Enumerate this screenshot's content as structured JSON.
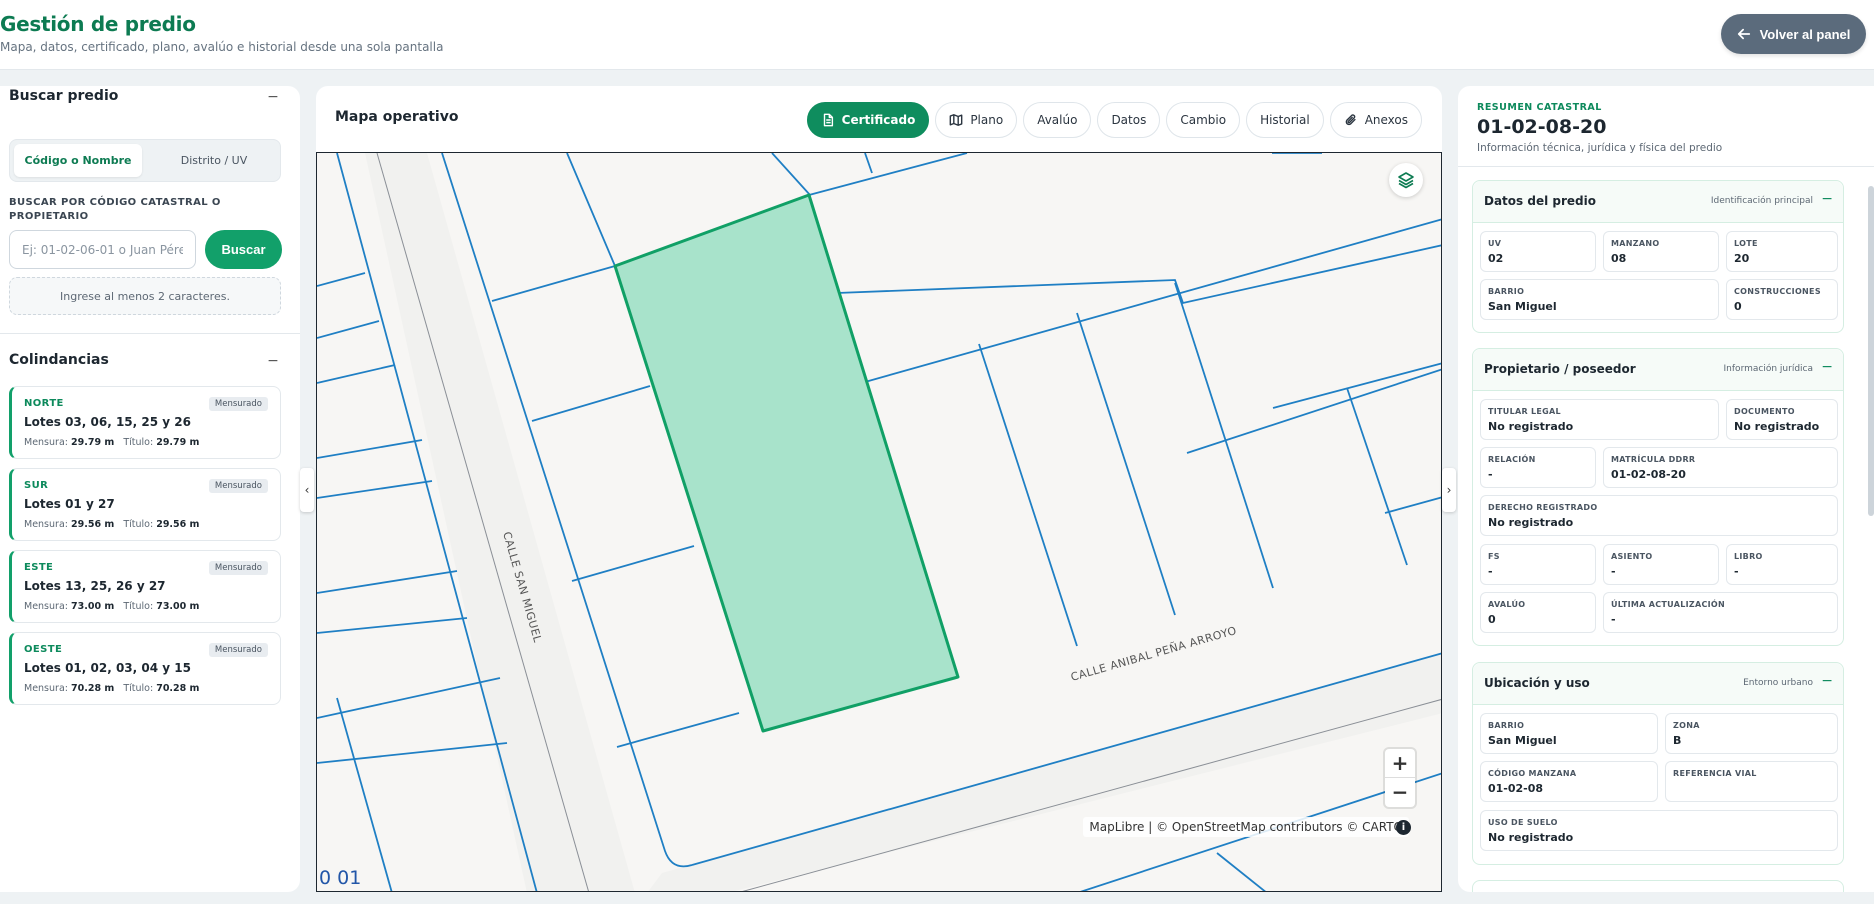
{
  "header": {
    "title": "Gestión de predio",
    "subtitle": "Mapa, datos, certificado, plano, avalúo e historial desde una sola pantalla",
    "back_label": "Volver al panel",
    "back_icon": "arrow-left-icon"
  },
  "search": {
    "title": "Buscar predio",
    "collapse": "−",
    "mode_code": "Código o Nombre",
    "mode_district": "Distrito / UV",
    "label": "BUSCAR POR CÓDIGO CATASTRAL O PROPIETARIO",
    "placeholder": "Ej: 01-02-06-01 o Juan Pérez",
    "button": "Buscar",
    "hint": "Ingrese al menos 2 caracteres."
  },
  "colindancias": {
    "title": "Colindancias",
    "collapse": "−",
    "mensura_label": "Mensura:",
    "titulo_label": "Título:",
    "items": [
      {
        "dir": "NORTE",
        "badge": "Mensurado",
        "lotes": "Lotes 03, 06, 15, 25 y 26",
        "mensura": "29.79 m",
        "titulo": "29.79 m"
      },
      {
        "dir": "SUR",
        "badge": "Mensurado",
        "lotes": "Lotes 01 y 27",
        "mensura": "29.56 m",
        "titulo": "29.56 m"
      },
      {
        "dir": "ESTE",
        "badge": "Mensurado",
        "lotes": "Lotes 13, 25, 26 y 27",
        "mensura": "73.00 m",
        "titulo": "73.00 m"
      },
      {
        "dir": "OESTE",
        "badge": "Mensurado",
        "lotes": "Lotes 01, 02, 03, 04 y 15",
        "mensura": "70.28 m",
        "titulo": "70.28 m"
      }
    ]
  },
  "map": {
    "title": "Mapa operativo",
    "tabs": [
      {
        "label": "Certificado",
        "icon": "document-icon"
      },
      {
        "label": "Plano",
        "icon": "map-icon"
      },
      {
        "label": "Avalúo",
        "icon": ""
      },
      {
        "label": "Datos",
        "icon": ""
      },
      {
        "label": "Cambio",
        "icon": ""
      },
      {
        "label": "Historial",
        "icon": ""
      },
      {
        "label": "Anexos",
        "icon": "paperclip-icon"
      }
    ],
    "street_1": "CALLE SAN MIGUEL",
    "street_2": "CALLE ANIBAL PEÑA ARROYO",
    "lot_label": "0 01",
    "attribution": "MapLibre | © OpenStreetMap contributors © CARTO",
    "zoom_in": "+",
    "zoom_out": "−",
    "info": "i",
    "handle_left": "‹",
    "handle_right": "›",
    "parcel_fill": "#a8e3cb",
    "parcel_stroke": "#11a066",
    "lot_lines": "#1f7fc4"
  },
  "summary": {
    "eyebrow": "RESUMEN CATASTRAL",
    "code": "01-02-08-20",
    "description": "Información técnica, jurídica y física del predio",
    "groups": {
      "predio": {
        "title": "Datos del predio",
        "tag": "Identificación principal",
        "collapse": "−",
        "fields": [
          {
            "label": "UV",
            "value": "02"
          },
          {
            "label": "MANZANO",
            "value": "08"
          },
          {
            "label": "LOTE",
            "value": "20"
          },
          {
            "label": "BARRIO",
            "value": "San Miguel"
          },
          {
            "label": "CONSTRUCCIONES",
            "value": "0"
          }
        ]
      },
      "propietario": {
        "title": "Propietario / poseedor",
        "tag": "Información jurídica",
        "collapse": "−",
        "fields": [
          {
            "label": "TITULAR LEGAL",
            "value": "No registrado"
          },
          {
            "label": "DOCUMENTO",
            "value": "No registrado"
          },
          {
            "label": "RELACIÓN",
            "value": "-"
          },
          {
            "label": "MATRÍCULA DDRR",
            "value": "01-02-08-20"
          },
          {
            "label": "DERECHO REGISTRADO",
            "value": "No registrado"
          },
          {
            "label": "FS",
            "value": "-"
          },
          {
            "label": "ASIENTO",
            "value": "-"
          },
          {
            "label": "LIBRO",
            "value": "-"
          },
          {
            "label": "AVALÚO",
            "value": "0"
          },
          {
            "label": "ÚLTIMA ACTUALIZACIÓN",
            "value": "-"
          }
        ]
      },
      "ubicacion": {
        "title": "Ubicación y uso",
        "tag": "Entorno urbano",
        "collapse": "−",
        "fields": [
          {
            "label": "BARRIO",
            "value": "San Miguel"
          },
          {
            "label": "ZONA",
            "value": "B"
          },
          {
            "label": "CÓDIGO MANZANA",
            "value": "01-02-08"
          },
          {
            "label": "REFERENCIA VIAL",
            "value": ""
          },
          {
            "label": "USO DE SUELO",
            "value": "No registrado"
          }
        ]
      }
    }
  }
}
